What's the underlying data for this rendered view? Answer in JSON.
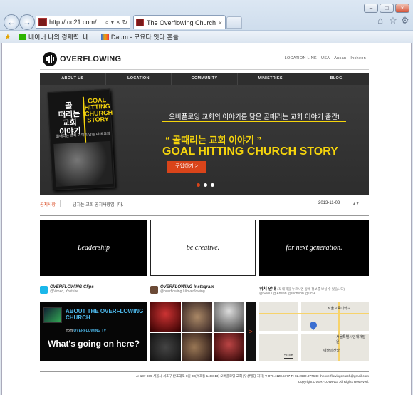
{
  "browser": {
    "address": "http://toc21.com/",
    "address_tools": [
      "⌕",
      "▾",
      "×",
      "↻"
    ],
    "tab_title": "The Overflowing Church",
    "tab_close": "×",
    "window_buttons": [
      "–",
      "□",
      "×"
    ],
    "nav_back": "←",
    "nav_forward": "→",
    "toolbar_icons": [
      "⌂",
      "☆",
      "⚙"
    ],
    "favorites": [
      {
        "label": "네이버 나의 경제력, 네...",
        "color": "#2db400"
      },
      {
        "label": "Daum - 모요다 잇다 흔들...",
        "color": "#f2a900"
      }
    ]
  },
  "site": {
    "logo_text": "OVERFLOWING",
    "location_links": {
      "label": "LOCATION LINK",
      "items": [
        "USA",
        "Ansan",
        "Incheon"
      ]
    },
    "nav": [
      "ABOUT US",
      "LOCATION",
      "COMMUNITY",
      "MINISTRIES",
      "BLOG"
    ],
    "banner": {
      "book_korean": "골\n때리는\n교회\n이야기",
      "book_english": "GOAL\nHITTING\nCHURCH\nSTORY",
      "book_sub": "골때리는 교회 이야기 많은 미래 교회",
      "line1": "오버플로잉 교회의 이야기를 담은 골때리는 교회 이야기 출간!",
      "line2": "“ 골때리는 교회 이야기 ”",
      "line3": "GOAL HITTING CHURCH STORY",
      "buy_label": "구입하기  >",
      "dots": [
        true,
        false,
        false
      ]
    },
    "notice": {
      "tag": "공지사항",
      "text": "넘치는 교회 공지사항입니다.",
      "date": "2013-11-03",
      "arrows": "▴ ▾"
    },
    "tiles": [
      "Leadership",
      "be creative.",
      "for next generation."
    ],
    "clips": {
      "title": "OVERFLOWING Clips",
      "sub": "@Vimeo, Youtube"
    },
    "instagram": {
      "title": "OVERFLOWING Instagram",
      "sub": "@overflowing / #overflowing"
    },
    "location": {
      "title": "위치 안내",
      "note": "(각 대학을 누르시면 상세 정보를 보실 수 있습니다)",
      "sub": "@Seoul  @Ansan  @Incheon  @USA"
    },
    "video": {
      "title": "ABOUT THE OVERFLOWING CHURCH",
      "from_prefix": "from",
      "from_name": "OVERFLOWING TV",
      "big": "What's going on here?"
    },
    "map_labels": [
      "서울교육대학교",
      "서울특별시인재개발원",
      "예술의전당",
      "500m"
    ],
    "footer": {
      "line1": "A: 137-889 서울시 서초구 반포대로 8길 30(서초동 1488-13) 오버플로잉 교회 [우상빌딩 지하]     T: 070.4128.5777     F: 02.2632.8776     E: theoverflowingchurch@gmail.com",
      "line2": "Copyright OVERFLOWING. All Rights Reserved."
    }
  }
}
